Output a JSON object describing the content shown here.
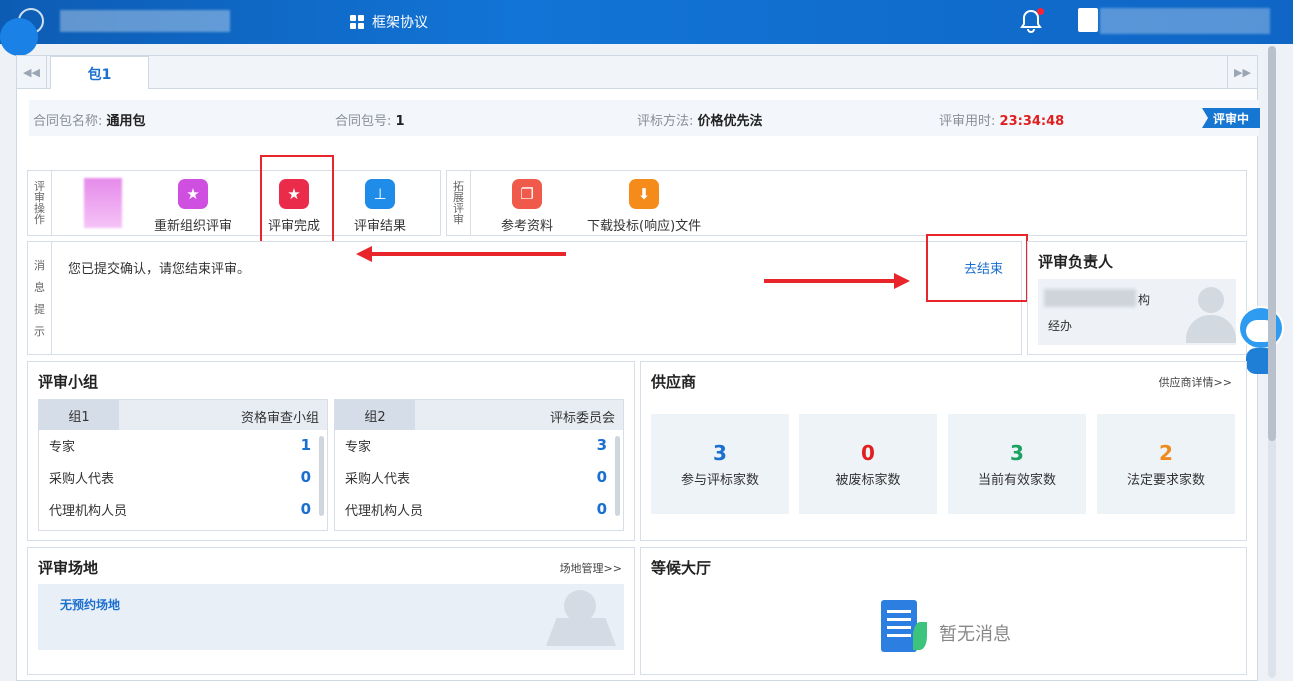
{
  "topbar": {
    "nav_label": "框架协议",
    "icons": {
      "bell": "bell-icon",
      "user": "user-icon",
      "nav": "grid-icon"
    }
  },
  "tabs": [
    {
      "label": "包1",
      "active": true
    }
  ],
  "info": {
    "package_name_key": "合同包名称:",
    "package_name_val": "通用包",
    "package_no_key": "合同包号:",
    "package_no_val": "1",
    "method_key": "评标方法:",
    "method_val": "价格优先法",
    "time_key": "评审用时:",
    "time_val": "23:34:48",
    "status": "评审中"
  },
  "ops": {
    "group1_label": [
      "评",
      "审",
      "操",
      "作"
    ],
    "group2_label": [
      "拓",
      "展",
      "评",
      "审"
    ],
    "buttons": [
      {
        "label": "重新组织评审",
        "icon": "star-icon",
        "color": "#cf4fe0"
      },
      {
        "label": "评审完成",
        "icon": "star-icon",
        "color": "#ea2b4a"
      },
      {
        "label": "评审结果",
        "icon": "stamp-icon",
        "color": "#1e8ce8"
      }
    ],
    "ext_buttons": [
      {
        "label": "参考资料",
        "icon": "copy-icon",
        "color": "#f05a4b"
      },
      {
        "label": "下载投标(响应)文件",
        "icon": "download-icon",
        "color": "#f58b1a"
      }
    ]
  },
  "message": {
    "label": [
      "消",
      "息",
      "提",
      "示"
    ],
    "text": "您已提交确认，请您结束评审。",
    "link": "去结束"
  },
  "leader": {
    "title": "评审负责人",
    "org_suffix": "构",
    "role": "经办"
  },
  "panel_group": {
    "title": "评审小组",
    "groups": [
      {
        "name": "组1",
        "type": "资格审查小组",
        "rows": [
          {
            "label": "专家",
            "value": "1"
          },
          {
            "label": "采购人代表",
            "value": "0"
          },
          {
            "label": "代理机构人员",
            "value": "0"
          }
        ]
      },
      {
        "name": "组2",
        "type": "评标委员会",
        "rows": [
          {
            "label": "专家",
            "value": "3"
          },
          {
            "label": "采购人代表",
            "value": "0"
          },
          {
            "label": "代理机构人员",
            "value": "0"
          }
        ]
      }
    ]
  },
  "suppliers": {
    "title": "供应商",
    "more": "供应商详情>>",
    "stats": [
      {
        "value": "3",
        "label": "参与评标家数",
        "color": "#1a6fcf"
      },
      {
        "value": "0",
        "label": "被废标家数",
        "color": "#e02020"
      },
      {
        "value": "3",
        "label": "当前有效家数",
        "color": "#1aa260"
      },
      {
        "value": "2",
        "label": "法定要求家数",
        "color": "#f08a1c"
      }
    ]
  },
  "venue": {
    "title": "评审场地",
    "more": "场地管理>>",
    "empty": "无预约场地"
  },
  "lobby": {
    "title": "等候大厅",
    "empty": "暂无消息"
  }
}
